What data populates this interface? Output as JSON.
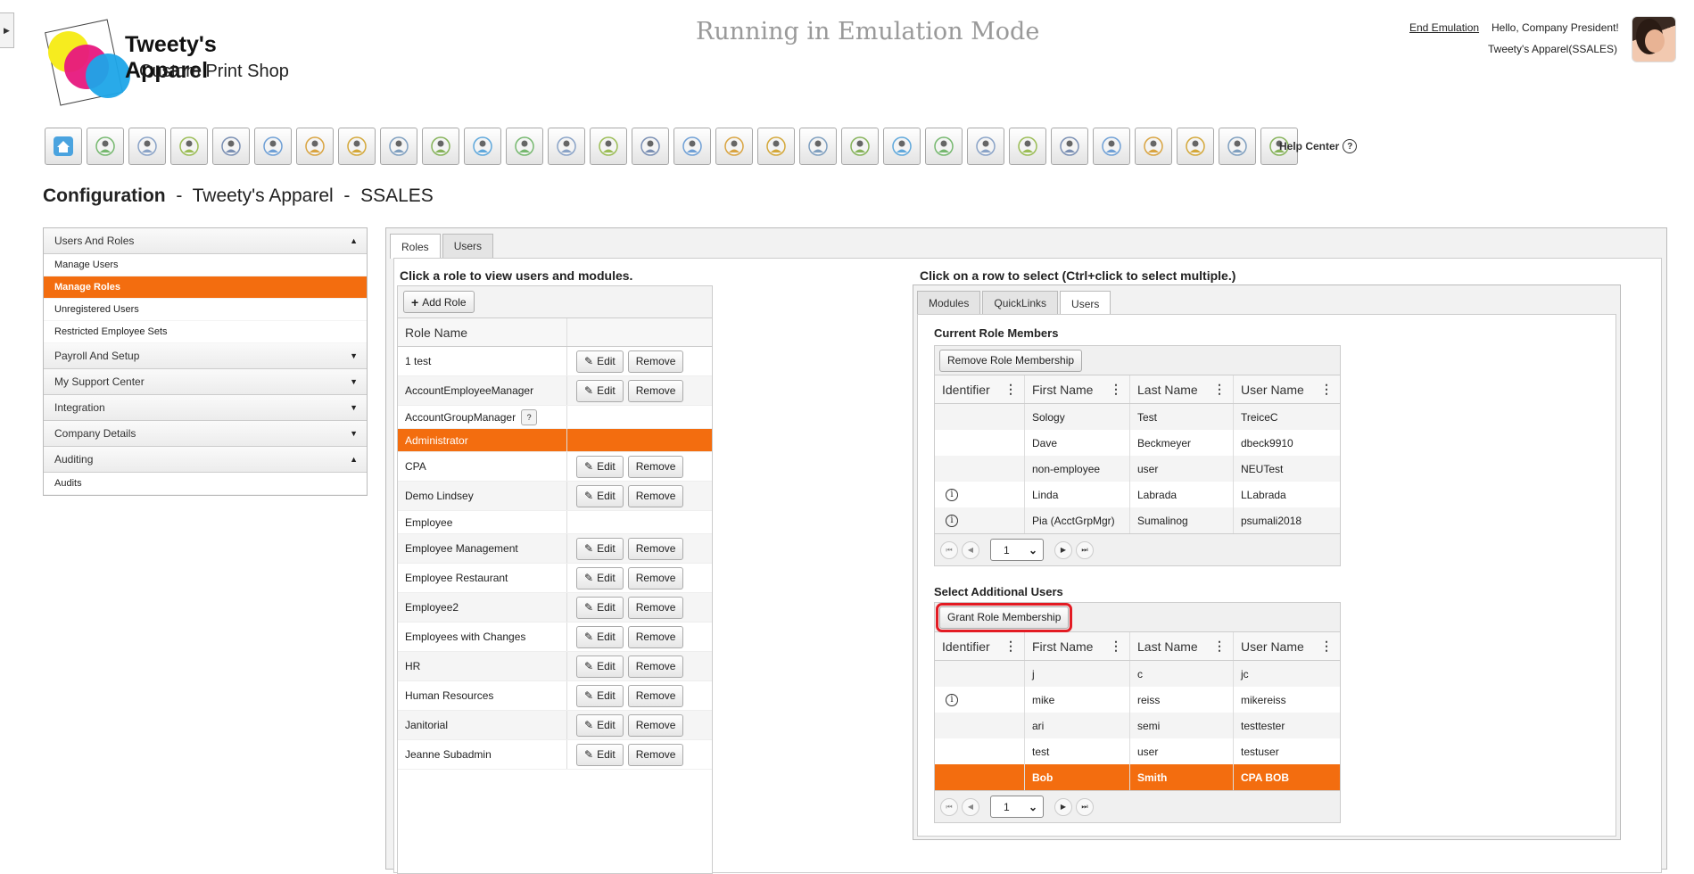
{
  "header": {
    "brand_name": "Tweety's Apparel",
    "brand_sub": "Custom Print Shop",
    "emulation_banner": "Running in Emulation Mode",
    "end_emulation": "End Emulation",
    "greeting": "Hello, Company President!",
    "company_code": "Tweety's Apparel(SSALES)",
    "help_center": "Help Center"
  },
  "toolbar": {
    "icons": [
      "home-icon",
      "target-person-icon",
      "money-people-icon",
      "presenter-icon",
      "group-icon",
      "org-chart-icon",
      "report-icon",
      "money-bag-icon",
      "search-people-icon",
      "crosshair-icon",
      "crosshair-icon",
      "growth-people-icon",
      "crosshair-icon",
      "people-transfer-icon",
      "people-money-icon",
      "shield-person-icon",
      "network-person-icon",
      "people-transfer-icon",
      "calendar-cancel-icon",
      "fingerprint-icon",
      "money-bag-icon",
      "people-money-icon",
      "people-crowd-icon",
      "clipboard-add-icon",
      "shield-person-icon",
      "search-document-icon",
      "gift-icon",
      "document-icon",
      "presentation-people-icon",
      "settings-people-icon"
    ]
  },
  "page": {
    "title_main": "Configuration",
    "title_company": "Tweety's Apparel",
    "title_code": "SSALES",
    "sep": "-"
  },
  "leftnav": {
    "sections": [
      {
        "label": "Users And Roles",
        "expanded": true,
        "items": [
          "Manage Users",
          "Manage Roles",
          "Unregistered Users",
          "Restricted Employee Sets"
        ],
        "active": "Manage Roles"
      },
      {
        "label": "Payroll And Setup",
        "expanded": false
      },
      {
        "label": "My Support Center",
        "expanded": false
      },
      {
        "label": "Integration",
        "expanded": false
      },
      {
        "label": "Company Details",
        "expanded": false
      },
      {
        "label": "Auditing",
        "expanded": true,
        "items": [
          "Audits"
        ]
      }
    ]
  },
  "main": {
    "tabs": [
      "Roles",
      "Users"
    ],
    "active_tab": "Roles",
    "roles_instruction": "Click a role to view users and modules.",
    "add_role": "Add Role",
    "role_col": "Role Name",
    "edit_label": "Edit",
    "remove_label": "Remove",
    "roles": [
      {
        "name": "1 test",
        "actions": true
      },
      {
        "name": "AccountEmployeeManager",
        "actions": true
      },
      {
        "name": "AccountGroupManager",
        "actions": false,
        "help": "?"
      },
      {
        "name": "Administrator",
        "actions": false,
        "selected": true
      },
      {
        "name": "CPA",
        "actions": true
      },
      {
        "name": "Demo Lindsey",
        "actions": true
      },
      {
        "name": "Employee",
        "actions": false
      },
      {
        "name": "Employee Management",
        "actions": true
      },
      {
        "name": "Employee Restaurant",
        "actions": true
      },
      {
        "name": "Employee2",
        "actions": true
      },
      {
        "name": "Employees with Changes",
        "actions": true
      },
      {
        "name": "HR",
        "actions": true
      },
      {
        "name": "Human Resources",
        "actions": true
      },
      {
        "name": "Janitorial",
        "actions": true
      },
      {
        "name": "Jeanne Subadmin",
        "actions": true
      }
    ]
  },
  "right": {
    "instruction": "Click on a row to select (Ctrl+click to select multiple.)",
    "tabs": [
      "Modules",
      "QuickLinks",
      "Users"
    ],
    "active_tab": "Users",
    "current_title": "Current Role Members",
    "remove_membership": "Remove Role Membership",
    "columns": [
      "Identifier",
      "First Name",
      "Last Name",
      "User Name"
    ],
    "current_members": [
      {
        "id": "",
        "first": "Sology",
        "last": "Test",
        "user": "TreiceC"
      },
      {
        "id": "",
        "first": "Dave",
        "last": "Beckmeyer",
        "user": "dbeck9910"
      },
      {
        "id": "",
        "first": "non-employee",
        "last": "user",
        "user": "NEUTest"
      },
      {
        "id": "i",
        "first": "Linda",
        "last": "Labrada",
        "user": "LLabrada"
      },
      {
        "id": "i",
        "first": "Pia (AcctGrpMgr)",
        "last": "Sumalinog",
        "user": "psumali2018"
      }
    ],
    "page_value": "1",
    "additional_title": "Select Additional Users",
    "grant_membership": "Grant Role Membership",
    "additional_users": [
      {
        "id": "",
        "first": "j",
        "last": "c",
        "user": "jc"
      },
      {
        "id": "i",
        "first": "mike",
        "last": "reiss",
        "user": "mikereiss"
      },
      {
        "id": "",
        "first": "ari",
        "last": "semi",
        "user": "testtester"
      },
      {
        "id": "",
        "first": "test",
        "last": "user",
        "user": "testuser"
      },
      {
        "id": "",
        "first": "Bob",
        "last": "Smith",
        "user": "CPA BOB",
        "selected": true
      }
    ]
  },
  "colors": {
    "accent": "#f36d0f",
    "highlight_box": "#e31b23"
  }
}
